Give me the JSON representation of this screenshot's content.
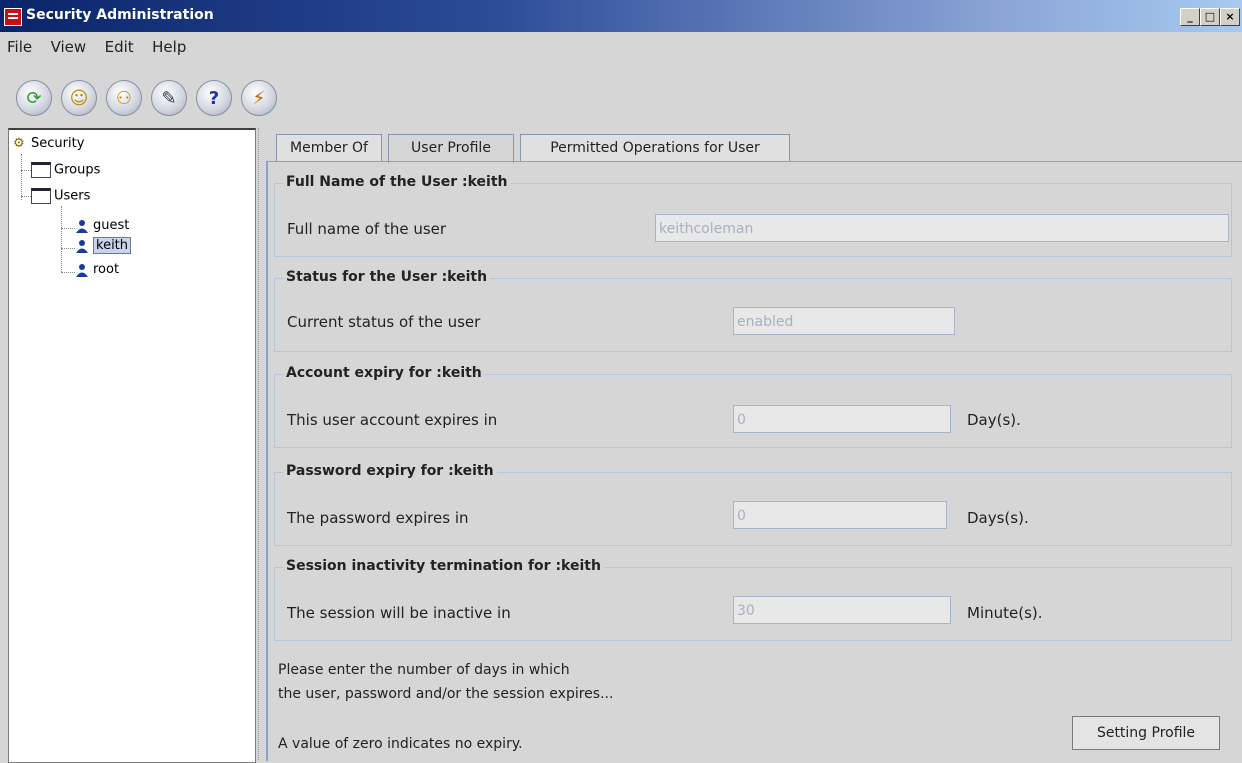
{
  "window": {
    "title": "Security Administration"
  },
  "menubar": {
    "items": [
      "File",
      "View",
      "Edit",
      "Help"
    ]
  },
  "toolbar": {
    "icons": [
      "refresh-icon",
      "add-user-icon",
      "add-group-icon",
      "edit-icon",
      "help-icon",
      "exit-icon"
    ]
  },
  "tree": {
    "root": "Security",
    "groups": "Groups",
    "users": "Users",
    "user_items": [
      "guest",
      "keith",
      "root"
    ],
    "selected": "keith"
  },
  "tabs": [
    "Member Of",
    "User Profile",
    "Permitted Operations for User"
  ],
  "active_tab": "User Profile",
  "sections": {
    "fullname": {
      "title": "Full Name of the User :keith",
      "label": "Full name of the user",
      "value": "keithcoleman"
    },
    "status": {
      "title": "Status for the User :keith",
      "label": "Current status of the user",
      "value": "enabled"
    },
    "account": {
      "title": "Account expiry for :keith",
      "label": "This user account expires in",
      "value": "0",
      "unit": "Day(s)."
    },
    "password": {
      "title": "Password expiry for :keith",
      "label": "The password expires in",
      "value": "0",
      "unit": "Days(s)."
    },
    "session": {
      "title": "Session inactivity termination for :keith",
      "label": "The session will be inactive in",
      "value": "30",
      "unit": "Minute(s)."
    }
  },
  "notes": {
    "line1": "Please enter the number of days in which",
    "line2": "the user, password and/or the session expires...",
    "line3": "A value of zero indicates no expiry."
  },
  "button": {
    "label": "Setting Profile"
  }
}
